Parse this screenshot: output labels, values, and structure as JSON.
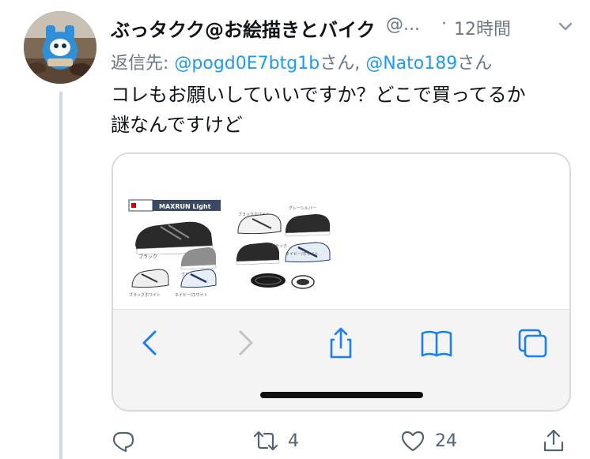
{
  "tweet": {
    "display_name": "ぶっタクク@お絵描きとバイク",
    "handle": "@...",
    "separator": "·",
    "timestamp": "12時間",
    "reply_prefix": "返信先: ",
    "reply_mentions": [
      {
        "handle": "@pogd0E7btg1b",
        "suffix": "さん, "
      },
      {
        "handle": "@Nato189",
        "suffix": "さん"
      }
    ],
    "text_lines": [
      "コレもお願いしていいですか？どこで買ってるか",
      "謎なんですけど"
    ],
    "media": {
      "brand_label": "MAXRUN Light",
      "browser_icons": [
        "back-arrow-icon",
        "forward-arrow-icon",
        "share-icon",
        "bookmarks-icon",
        "tabs-icon"
      ],
      "back_enabled": true,
      "forward_enabled": false
    },
    "actions": {
      "reply_count": "",
      "retweet_count": "4",
      "like_count": "24",
      "share_count": ""
    },
    "colors": {
      "link_blue": "#1d9bf0",
      "secondary_text": "#6b7783",
      "thread_line": "#cfd9de",
      "browser_bar_bg": "#f4f4f4"
    }
  }
}
